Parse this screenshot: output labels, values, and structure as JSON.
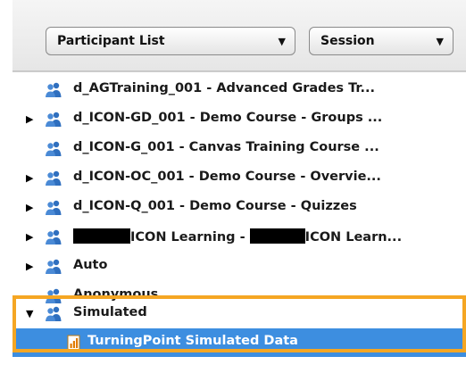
{
  "toolbar": {
    "participant_list": {
      "label": "Participant List"
    },
    "session": {
      "label": "Session"
    }
  },
  "tree": {
    "items": [
      {
        "label": "d_AGTraining_001 - Advanced Grades Tr...",
        "expandable": false,
        "icon": "participants-icon"
      },
      {
        "label": "d_ICON-GD_001 - Demo Course - Groups ...",
        "expandable": true,
        "icon": "participants-icon"
      },
      {
        "label": "d_ICON-G_001 - Canvas Training Course ...",
        "expandable": false,
        "icon": "participants-icon"
      },
      {
        "label": "d_ICON-OC_001 - Demo Course - Overvie...",
        "expandable": true,
        "icon": "participants-icon"
      },
      {
        "label": "d_ICON-Q_001 - Demo Course - Quizzes",
        "expandable": true,
        "icon": "participants-icon"
      },
      {
        "label_part1": "ICON Learning - ",
        "label_part2": "ICON Learn...",
        "expandable": true,
        "icon": "participants-icon",
        "redacted": true
      },
      {
        "label": "Auto",
        "expandable": true,
        "icon": "participants-icon"
      },
      {
        "label": "Anonymous",
        "expandable": false,
        "icon": "participants-icon"
      },
      {
        "label": "Simulated",
        "expandable": true,
        "expanded": true,
        "icon": "participants-icon"
      }
    ],
    "child": {
      "label": "TurningPoint Simulated Data",
      "icon": "data-file-icon",
      "selected": true
    }
  },
  "colors": {
    "highlight_border": "#f5a623",
    "selection": "#3d8ee0",
    "icon_blue": "#2f6fbf"
  }
}
